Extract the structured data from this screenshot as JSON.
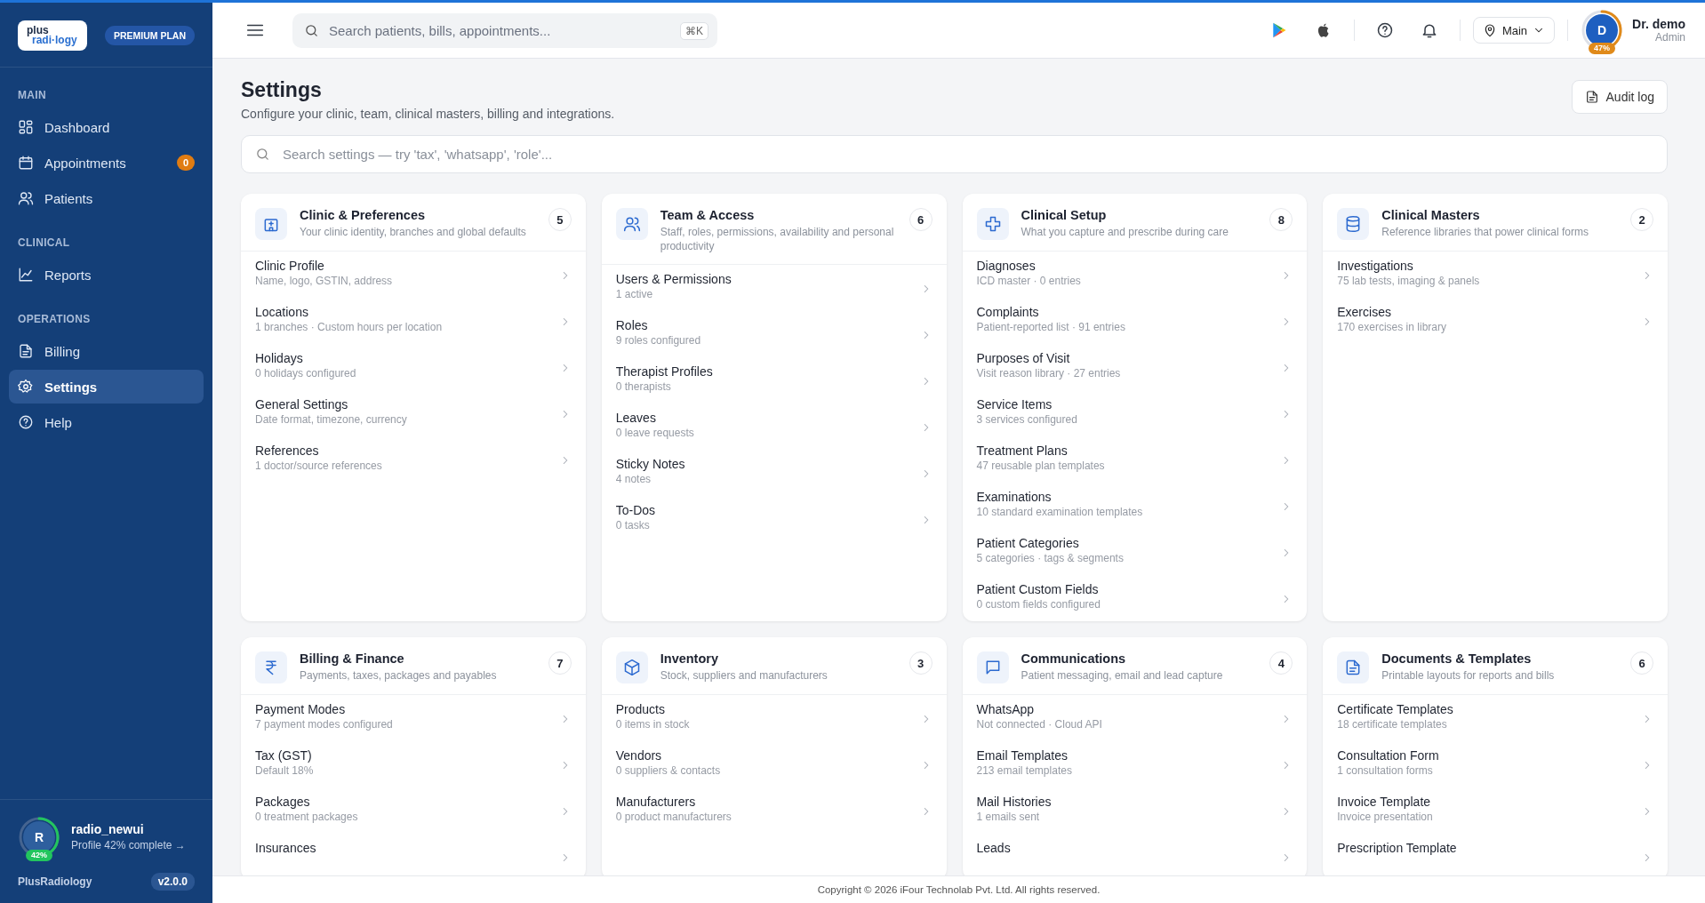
{
  "sidebar": {
    "logo": {
      "line1": "plus",
      "line2": "radi·logy"
    },
    "plan": "PREMIUM PLAN",
    "sections": [
      {
        "title": "MAIN",
        "items": [
          {
            "label": "Dashboard",
            "selected": false
          },
          {
            "label": "Appointments",
            "selected": false,
            "badge": "0"
          },
          {
            "label": "Patients",
            "selected": false
          }
        ]
      },
      {
        "title": "CLINICAL",
        "items": [
          {
            "label": "Reports",
            "selected": false
          }
        ]
      },
      {
        "title": "OPERATIONS",
        "items": [
          {
            "label": "Billing",
            "selected": false
          },
          {
            "label": "Settings",
            "selected": true
          },
          {
            "label": "Help",
            "selected": false
          }
        ]
      }
    ],
    "user": {
      "initial": "R",
      "level": 0.42,
      "percent": "42%",
      "name": "radio_newui",
      "progress": "Profile 42% complete →"
    },
    "brand": "PlusRadiology",
    "version": "v2.0.0"
  },
  "topbar": {
    "search": {
      "placeholder": "Search patients, bills, appointments...",
      "shortcut": "⌘K"
    },
    "location": "Main",
    "user": {
      "initial": "D",
      "level": 0.47,
      "percent": "47%",
      "name": "Dr. demo",
      "role": "Admin"
    }
  },
  "page": {
    "title": "Settings",
    "subtitle": "Configure your clinic, team, clinical masters, billing and integrations.",
    "audit_button": "Audit log",
    "search": {
      "placeholder": "Search settings — try 'tax', 'whatsapp', 'role'..."
    }
  },
  "cards": [
    {
      "title": "Clinic & Preferences",
      "subtitle": "Your clinic identity, branches and global defaults",
      "count": "5",
      "items": [
        {
          "title": "Clinic Profile",
          "detail": "Name, logo, GSTIN, address"
        },
        {
          "title": "Locations",
          "detail": "1 branches · Custom hours per location"
        },
        {
          "title": "Holidays",
          "detail": "0 holidays configured"
        },
        {
          "title": "General Settings",
          "detail": "Date format, timezone, currency"
        },
        {
          "title": "References",
          "detail": "1 doctor/source references"
        }
      ]
    },
    {
      "title": "Team & Access",
      "subtitle": "Staff, roles, permissions, availability and personal productivity",
      "count": "6",
      "items": [
        {
          "title": "Users & Permissions",
          "detail": "1 active"
        },
        {
          "title": "Roles",
          "detail": "9 roles configured"
        },
        {
          "title": "Therapist Profiles",
          "detail": "0 therapists"
        },
        {
          "title": "Leaves",
          "detail": "0 leave requests"
        },
        {
          "title": "Sticky Notes",
          "detail": "4 notes"
        },
        {
          "title": "To-Dos",
          "detail": "0 tasks"
        }
      ]
    },
    {
      "title": "Clinical Setup",
      "subtitle": "What you capture and prescribe during care",
      "count": "8",
      "items": [
        {
          "title": "Diagnoses",
          "detail": "ICD master · 0 entries"
        },
        {
          "title": "Complaints",
          "detail": "Patient-reported list · 91 entries"
        },
        {
          "title": "Purposes of Visit",
          "detail": "Visit reason library · 27 entries"
        },
        {
          "title": "Service Items",
          "detail": "3 services configured"
        },
        {
          "title": "Treatment Plans",
          "detail": "47 reusable plan templates"
        },
        {
          "title": "Examinations",
          "detail": "10 standard examination templates"
        },
        {
          "title": "Patient Categories",
          "detail": "5 categories · tags & segments"
        },
        {
          "title": "Patient Custom Fields",
          "detail": "0 custom fields configured"
        }
      ]
    },
    {
      "title": "Clinical Masters",
      "subtitle": "Reference libraries that power clinical forms",
      "count": "2",
      "items": [
        {
          "title": "Investigations",
          "detail": "75 lab tests, imaging & panels"
        },
        {
          "title": "Exercises",
          "detail": "170 exercises in library"
        }
      ]
    },
    {
      "title": "Billing & Finance",
      "subtitle": "Payments, taxes, packages and payables",
      "count": "7",
      "items": [
        {
          "title": "Payment Modes",
          "detail": "7 payment modes configured"
        },
        {
          "title": "Tax (GST)",
          "detail": "Default 18%"
        },
        {
          "title": "Packages",
          "detail": "0 treatment packages"
        },
        {
          "title": "Insurances"
        }
      ]
    },
    {
      "title": "Inventory",
      "subtitle": "Stock, suppliers and manufacturers",
      "count": "3",
      "items": [
        {
          "title": "Products",
          "detail": "0 items in stock"
        },
        {
          "title": "Vendors",
          "detail": "0 suppliers & contacts"
        },
        {
          "title": "Manufacturers",
          "detail": "0 product manufacturers"
        }
      ]
    },
    {
      "title": "Communications",
      "subtitle": "Patient messaging, email and lead capture",
      "count": "4",
      "items": [
        {
          "title": "WhatsApp",
          "detail": "Not connected · Cloud API"
        },
        {
          "title": "Email Templates",
          "detail": "213 email templates"
        },
        {
          "title": "Mail Histories",
          "detail": "1 emails sent"
        },
        {
          "title": "Leads"
        }
      ]
    },
    {
      "title": "Documents & Templates",
      "subtitle": "Printable layouts for reports and bills",
      "count": "6",
      "items": [
        {
          "title": "Certificate Templates",
          "detail": "18 certificate templates"
        },
        {
          "title": "Consultation Form",
          "detail": "1 consultation forms"
        },
        {
          "title": "Invoice Template",
          "detail": "Invoice presentation"
        },
        {
          "title": "Prescription Template"
        }
      ]
    }
  ],
  "footer": {
    "copyright": "Copyright © 2026 iFour Technolab Pvt. Ltd. All rights reserved."
  }
}
